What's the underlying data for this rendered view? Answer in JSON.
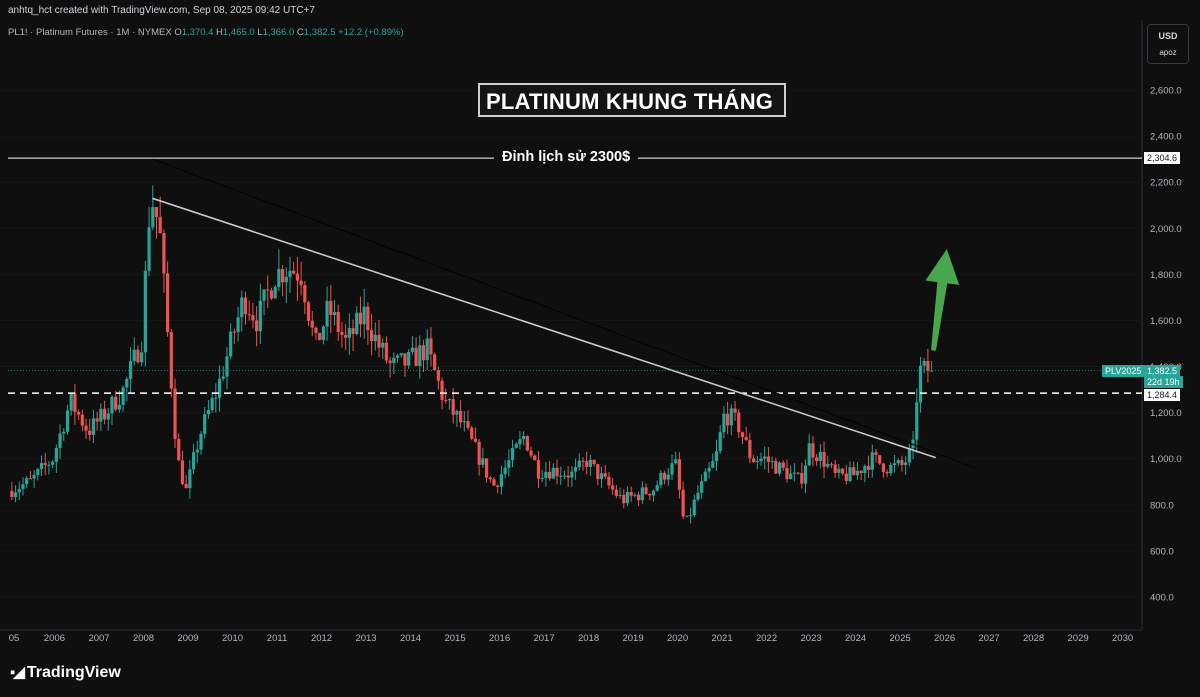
{
  "header": {
    "credit": "anhtq_hct created with TradingView.com, Sep 08, 2025 09:42 UTC+7",
    "symbol_line": "PL1! · Platinum Futures · 1M · NYMEX",
    "ohlc": {
      "o_label": "O",
      "o_value": "1,370.4",
      "h_label": "H",
      "h_value": "1,465.0",
      "l_label": "L",
      "l_value": "1,366.0",
      "c_label": "C",
      "c_value": "1,382.5",
      "change": "+12.2 (+0.89%)"
    }
  },
  "currency_box": {
    "currency": "USD",
    "mode": "apoz"
  },
  "annotations": {
    "title": "PLATINUM KHUNG THÁNG",
    "ath_label": "Đỉnh lịch sử 2300$"
  },
  "price_tags": {
    "ath": "2,304.6",
    "series_name": "PLV2025",
    "last_price": "1,382.5",
    "countdown": "22d 19h",
    "support": "1,284.4"
  },
  "brand": {
    "name": "TradingView"
  },
  "colors": {
    "up": "#26a69a",
    "down": "#ef5350",
    "background": "#0f0f0f",
    "arrow": "#4caf50"
  },
  "chart_data": {
    "type": "candlestick",
    "yaxis": {
      "ticks": [
        400,
        600,
        800,
        1000,
        1200,
        1400,
        1600,
        1800,
        2000,
        2200,
        2400,
        2600
      ],
      "tick_labels": [
        "400.0",
        "600.0",
        "800.0",
        "1,000.0",
        "1,200.0",
        "1,400.0",
        "1,600.0",
        "1,800.0",
        "2,000.0",
        "2,200.0",
        "2,400.0",
        "2,600.0"
      ],
      "range": [
        260,
        2790
      ]
    },
    "xaxis": {
      "labels": [
        "05",
        "2006",
        "2007",
        "2008",
        "2009",
        "2010",
        "2011",
        "2012",
        "2013",
        "2014",
        "2015",
        "2016",
        "2017",
        "2018",
        "2019",
        "2020",
        "2021",
        "2022",
        "2023",
        "2024",
        "2025",
        "2026",
        "2027",
        "2028",
        "2029",
        "2030"
      ],
      "range": [
        2005.0,
        2031.0
      ]
    },
    "horizontal_lines": [
      {
        "value": 2304.6,
        "style": "solid"
      },
      {
        "value": 1284.4,
        "style": "dashed"
      }
    ],
    "trendlines": [
      {
        "from": [
          2008.2,
          2130
        ],
        "to": [
          2025.8,
          1005
        ],
        "style": "solid-light"
      },
      {
        "from": [
          2008.2,
          2300
        ],
        "to": [
          2026.7,
          960
        ],
        "style": "solid-dark"
      }
    ],
    "price_path": [
      [
        2005.0,
        860
      ],
      [
        2005.5,
        900
      ],
      [
        2006.0,
        1000
      ],
      [
        2006.4,
        1250
      ],
      [
        2006.8,
        1120
      ],
      [
        2007.2,
        1200
      ],
      [
        2007.6,
        1300
      ],
      [
        2008.0,
        1520
      ],
      [
        2008.2,
        2150
      ],
      [
        2008.4,
        2000
      ],
      [
        2008.6,
        1500
      ],
      [
        2008.8,
        1000
      ],
      [
        2009.0,
        860
      ],
      [
        2009.3,
        1100
      ],
      [
        2009.7,
        1300
      ],
      [
        2010.0,
        1500
      ],
      [
        2010.3,
        1700
      ],
      [
        2010.6,
        1600
      ],
      [
        2011.0,
        1800
      ],
      [
        2011.3,
        1830
      ],
      [
        2011.6,
        1800
      ],
      [
        2011.9,
        1480
      ],
      [
        2012.2,
        1650
      ],
      [
        2012.6,
        1500
      ],
      [
        2013.0,
        1630
      ],
      [
        2013.3,
        1500
      ],
      [
        2013.6,
        1400
      ],
      [
        2014.0,
        1420
      ],
      [
        2014.4,
        1480
      ],
      [
        2014.8,
        1250
      ],
      [
        2015.2,
        1150
      ],
      [
        2015.6,
        1000
      ],
      [
        2015.9,
        880
      ],
      [
        2016.3,
        1000
      ],
      [
        2016.6,
        1100
      ],
      [
        2016.9,
        950
      ],
      [
        2017.3,
        950
      ],
      [
        2017.7,
        930
      ],
      [
        2018.0,
        990
      ],
      [
        2018.4,
        900
      ],
      [
        2018.8,
        820
      ],
      [
        2019.1,
        840
      ],
      [
        2019.5,
        870
      ],
      [
        2019.8,
        950
      ],
      [
        2020.0,
        970
      ],
      [
        2020.2,
        700
      ],
      [
        2020.5,
        850
      ],
      [
        2020.9,
        1000
      ],
      [
        2021.1,
        1200
      ],
      [
        2021.4,
        1150
      ],
      [
        2021.7,
        1000
      ],
      [
        2022.0,
        1000
      ],
      [
        2022.4,
        950
      ],
      [
        2022.8,
        900
      ],
      [
        2023.0,
        1050
      ],
      [
        2023.3,
        1000
      ],
      [
        2023.6,
        920
      ],
      [
        2024.0,
        930
      ],
      [
        2024.4,
        1000
      ],
      [
        2024.8,
        960
      ],
      [
        2025.1,
        970
      ],
      [
        2025.35,
        1050
      ],
      [
        2025.45,
        1380
      ],
      [
        2025.6,
        1382.5
      ]
    ],
    "arrow": {
      "from": [
        2025.75,
        1470
      ],
      "to": [
        2026.05,
        1910
      ]
    }
  }
}
